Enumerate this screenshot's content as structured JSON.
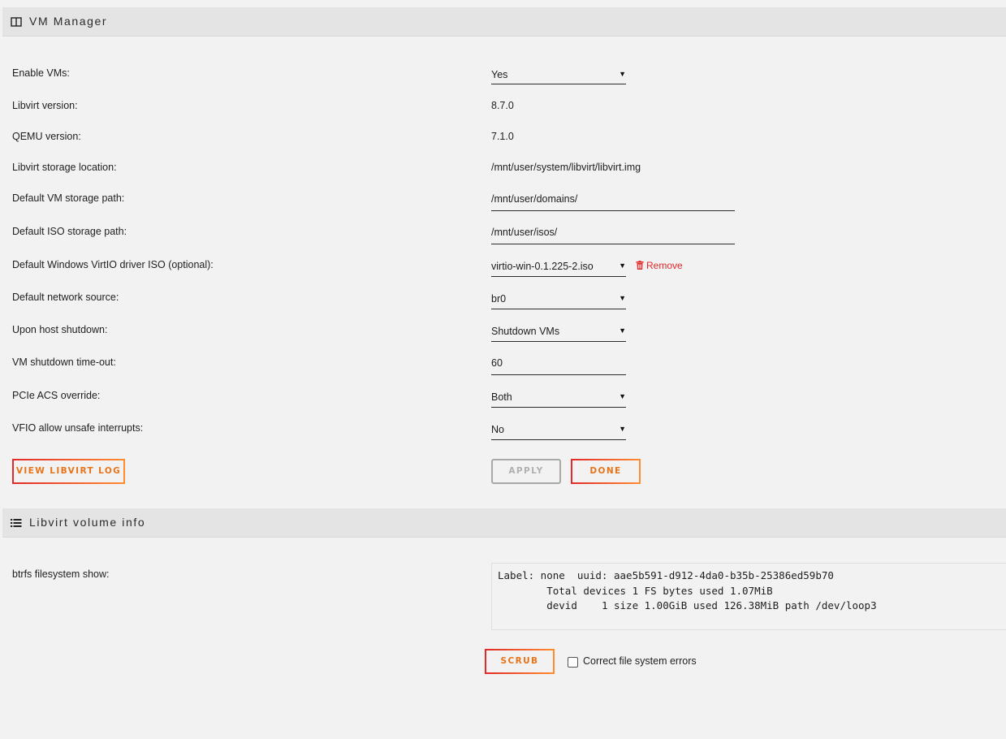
{
  "vm_manager": {
    "title": "VM Manager",
    "icon": "window-icon",
    "rows": {
      "enable_vms": {
        "label": "Enable VMs:",
        "value": "Yes"
      },
      "libvirt_version": {
        "label": "Libvirt version:",
        "value": "8.7.0"
      },
      "qemu_version": {
        "label": "QEMU version:",
        "value": "7.1.0"
      },
      "libvirt_storage_location": {
        "label": "Libvirt storage location:",
        "value": "/mnt/user/system/libvirt/libvirt.img"
      },
      "default_vm_storage_path": {
        "label": "Default VM storage path:",
        "value": "/mnt/user/domains/"
      },
      "default_iso_storage_path": {
        "label": "Default ISO storage path:",
        "value": "/mnt/user/isos/"
      },
      "virtio_iso": {
        "label": "Default Windows VirtIO driver ISO (optional):",
        "value": "virtio-win-0.1.225-2.iso",
        "remove_label": "Remove"
      },
      "network_source": {
        "label": "Default network source:",
        "value": "br0"
      },
      "host_shutdown": {
        "label": "Upon host shutdown:",
        "value": "Shutdown VMs"
      },
      "shutdown_timeout": {
        "label": "VM shutdown time-out:",
        "value": "60"
      },
      "pcie_acs": {
        "label": "PCIe ACS override:",
        "value": "Both"
      },
      "vfio_unsafe": {
        "label": "VFIO allow unsafe interrupts:",
        "value": "No"
      }
    },
    "buttons": {
      "view_log": "VIEW LIBVIRT LOG",
      "apply": "APPLY",
      "done": "DONE"
    }
  },
  "volume_info": {
    "title": "Libvirt volume info",
    "icon": "list-icon",
    "btrfs_label": "btrfs filesystem show:",
    "btrfs_output": "Label: none  uuid: aae5b591-d912-4da0-b35b-25386ed59b70\n\tTotal devices 1 FS bytes used 1.07MiB\n\tdevid    1 size 1.00GiB used 126.38MiB path /dev/loop3",
    "scrub_button": "SCRUB",
    "correct_errors_label": "Correct file system errors",
    "correct_errors_checked": false
  },
  "colors": {
    "accent_red": "#e22828",
    "accent_orange": "#ff8c2f",
    "background": "#f2f2f2",
    "header_bg": "#e4e4e4"
  }
}
